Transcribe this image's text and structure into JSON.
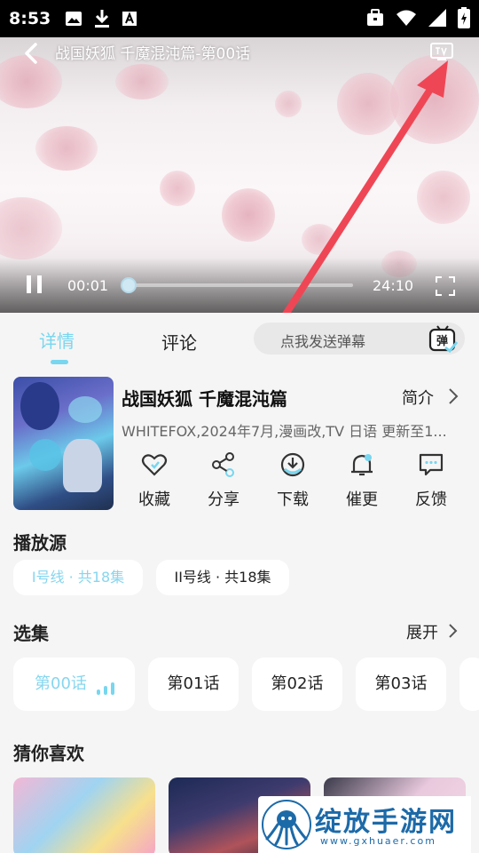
{
  "status_bar": {
    "time": "8:53"
  },
  "player": {
    "title": "战国妖狐 千魔混沌篇-第00话",
    "current_time": "00:01",
    "duration": "24:10",
    "progress": 0.0007
  },
  "tabs": {
    "detail": "详情",
    "comment": "评论",
    "danmaku_placeholder": "点我发送弹幕",
    "danmaku_icon_text": "弹"
  },
  "anime": {
    "title": "战国妖狐 千魔混沌篇",
    "intro_label": "简介",
    "meta": "WHITEFOX,2024年7月,漫画改,TV 日语 更新至1..."
  },
  "actions": [
    {
      "label": "收藏",
      "icon": "heart-icon"
    },
    {
      "label": "分享",
      "icon": "share-icon"
    },
    {
      "label": "下载",
      "icon": "download-icon"
    },
    {
      "label": "催更",
      "icon": "bell-icon"
    },
    {
      "label": "反馈",
      "icon": "feedback-icon"
    }
  ],
  "sources": {
    "title": "播放源",
    "items": [
      "I号线 · 共18集",
      "II号线 · 共18集"
    ]
  },
  "episodes": {
    "title": "选集",
    "expand_label": "展开",
    "items": [
      "第00话",
      "第01话",
      "第02话",
      "第03话"
    ]
  },
  "recommend": {
    "title": "猜你喜欢"
  },
  "watermark": {
    "name": "绽放手游网",
    "url": "www.gxhuaer.com"
  },
  "colors": {
    "accent": "#78d6ef",
    "arrow": "#ef4655",
    "background": "#f5f5f5"
  }
}
